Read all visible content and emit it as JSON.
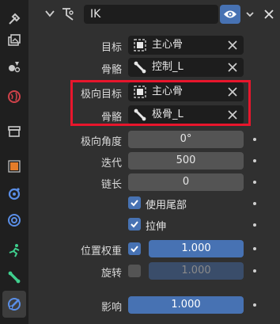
{
  "header": {
    "constraint_name": "IK"
  },
  "fields": {
    "target_label": "目标",
    "target_value": "主心骨",
    "bone_label": "骨骼",
    "bone_value": "控制_L",
    "pole_target_label": "极向目标",
    "pole_target_value": "主心骨",
    "pole_bone_label": "骨骼",
    "pole_bone_value": "极骨_L",
    "pole_angle_label": "极向角度",
    "pole_angle_value": "0°",
    "iterations_label": "迭代",
    "iterations_value": "500",
    "chain_length_label": "链长",
    "chain_length_value": "0",
    "use_tail_label": "使用尾部",
    "stretch_label": "拉伸",
    "weight_position_label": "位置权重",
    "weight_position_value": "1.000",
    "rotation_label": "旋转",
    "rotation_value": "1.000",
    "influence_label": "影响",
    "influence_value": "1.000"
  },
  "checkboxes": {
    "use_tail": true,
    "stretch": true,
    "weight_position": true,
    "rotation": false
  },
  "colors": {
    "accent": "#4772b3",
    "highlight_box": "#e8162c",
    "background": "#303030",
    "field_bg": "#1d1d1d"
  }
}
